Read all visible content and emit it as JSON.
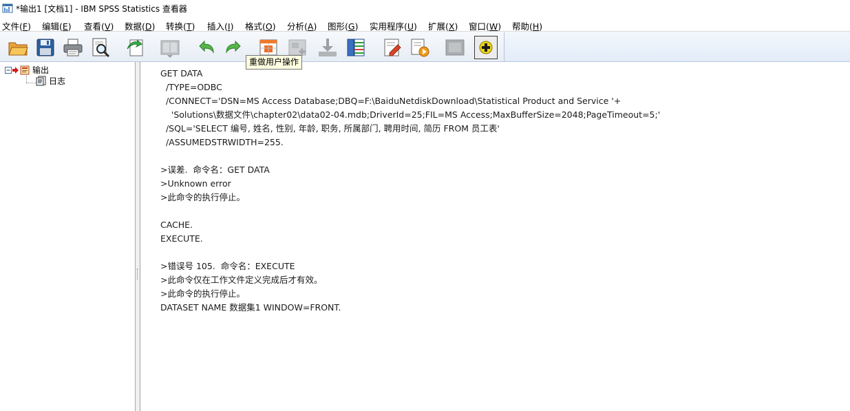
{
  "window": {
    "title": "*输出1 [文档1] - IBM SPSS Statistics 查看器",
    "icon": "spss-viewer-icon"
  },
  "menubar": {
    "items": [
      {
        "label": "文件(",
        "key": "F",
        "end": ")"
      },
      {
        "label": "编辑(",
        "key": "E",
        "end": ")"
      },
      {
        "label": "查看(",
        "key": "V",
        "end": ")"
      },
      {
        "label": "数据(",
        "key": "D",
        "end": ")"
      },
      {
        "label": "转换(",
        "key": "T",
        "end": ")"
      },
      {
        "label": "插入(",
        "key": "I",
        "end": ")"
      },
      {
        "label": "格式(",
        "key": "O",
        "end": ")"
      },
      {
        "label": "分析(",
        "key": "A",
        "end": ")"
      },
      {
        "label": "图形(",
        "key": "G",
        "end": ")"
      },
      {
        "label": "实用程序(",
        "key": "U",
        "end": ")"
      },
      {
        "label": "扩展(",
        "key": "X",
        "end": ")"
      },
      {
        "label": "窗口(",
        "key": "W",
        "end": ")"
      },
      {
        "label": "帮助(",
        "key": "H",
        "end": ")"
      }
    ]
  },
  "toolbar": {
    "buttons": [
      {
        "icon": "open-folder-icon",
        "enabled": true
      },
      {
        "icon": "save-icon",
        "enabled": true
      },
      {
        "icon": "print-icon",
        "enabled": true
      },
      {
        "icon": "print-preview-icon",
        "enabled": true
      },
      {
        "icon": "export-icon",
        "enabled": true
      },
      {
        "icon": "recall-dialog-icon",
        "enabled": false
      },
      {
        "icon": "undo-icon",
        "enabled": true
      },
      {
        "icon": "redo-icon",
        "enabled": true
      },
      {
        "icon": "goto-data-icon",
        "enabled": true
      },
      {
        "icon": "goto-case-icon",
        "enabled": false
      },
      {
        "icon": "goto-variable-icon",
        "enabled": false
      },
      {
        "icon": "variables-icon",
        "enabled": true
      },
      {
        "icon": "designate-window-icon",
        "enabled": true
      },
      {
        "icon": "run-script-icon",
        "enabled": true
      },
      {
        "icon": "show-all-icon",
        "enabled": false
      },
      {
        "icon": "add-item-icon",
        "enabled": true
      }
    ],
    "tooltip": "重做用户操作"
  },
  "outline": {
    "root_label": "输出",
    "child_label": "日志"
  },
  "log": {
    "lines": [
      "GET DATA",
      "  /TYPE=ODBC",
      "  /CONNECT='DSN=MS Access Database;DBQ=F:\\BaiduNetdiskDownload\\Statistical Product and Service '+",
      "    'Solutions\\数据文件\\chapter02\\data02-04.mdb;DriverId=25;FIL=MS Access;MaxBufferSize=2048;PageTimeout=5;'",
      "  /SQL='SELECT 编号, 姓名, 性别, 年龄, 职务, 所属部门, 聘用时间, 简历 FROM 员工表'",
      "  /ASSUMEDSTRWIDTH=255.",
      "",
      ">误差.  命令名：GET DATA",
      ">Unknown error",
      ">此命令的执行停止。",
      "",
      "CACHE.",
      "EXECUTE.",
      "",
      ">错误号 105.  命令名：EXECUTE",
      ">此命令仅在工作文件定义完成后才有效。",
      ">此命令的执行停止。",
      "DATASET NAME 数据集1 WINDOW=FRONT."
    ]
  }
}
